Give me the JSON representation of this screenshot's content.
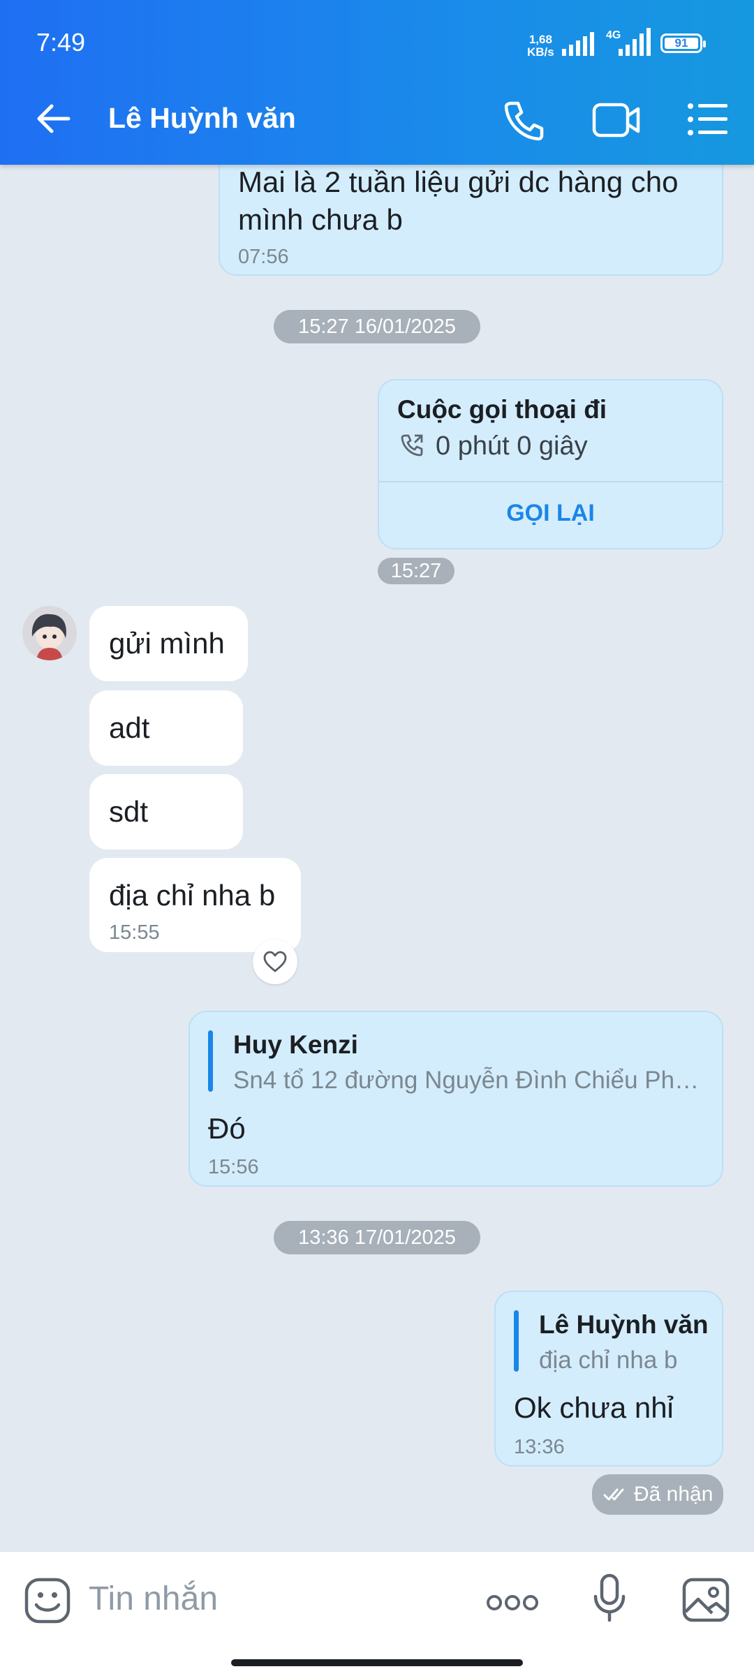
{
  "status_bar": {
    "time": "7:49",
    "net_speed_value": "1,68",
    "net_speed_unit": "KB/s",
    "network_type": "4G",
    "battery": "91"
  },
  "header": {
    "contact_name": "Lê Huỳnh văn"
  },
  "messages": {
    "m1": {
      "text_line1": "Mai là 2 tuần liệu gửi dc hàng cho",
      "text_line2": "mình chưa b",
      "time": "07:56"
    },
    "sep1": "15:27 16/01/2025",
    "call": {
      "title": "Cuộc gọi thoại đi",
      "duration": "0 phút 0 giây",
      "action": "GỌI LẠI",
      "time": "15:27"
    },
    "in1": "gửi mình",
    "in2": "adt",
    "in3": "sdt",
    "in4": {
      "text": "địa chỉ nha b",
      "time": "15:55"
    },
    "reply1": {
      "quoted_name": "Huy Kenzi",
      "quoted_text": "Sn4 tổ 12 đường Nguyễn Đình Chiểu Pha...",
      "text": "Đó",
      "time": "15:56"
    },
    "sep2": "13:36 17/01/2025",
    "reply2": {
      "quoted_name": "Lê Huỳnh văn",
      "quoted_text": "địa chỉ nha b",
      "text": "Ok chưa nhỉ",
      "time": "13:36"
    },
    "delivered": "Đã nhận"
  },
  "input": {
    "placeholder": "Tin nhắn"
  },
  "colors": {
    "header": "#1f6ff3",
    "background": "#e2e9f1",
    "bubble_out": "#d4edfc",
    "accent": "#1a86e8"
  }
}
